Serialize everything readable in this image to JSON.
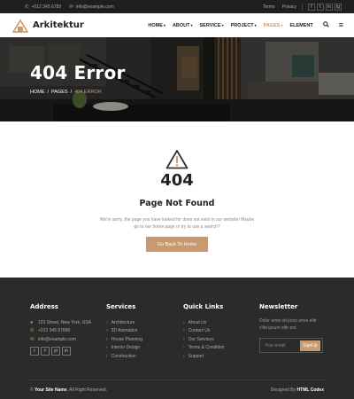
{
  "topbar": {
    "phone": "+012 345 6789",
    "email": "info@example.com",
    "links": [
      "Terms",
      "Privacy"
    ],
    "socials": [
      "f",
      "t",
      "in",
      "ig"
    ]
  },
  "brand": {
    "name": "Arkitektur",
    "accent": "#c89a6e"
  },
  "nav": {
    "items": [
      {
        "label": "HOME",
        "caret": true
      },
      {
        "label": "ABOUT",
        "caret": true
      },
      {
        "label": "SERVICE",
        "caret": true
      },
      {
        "label": "PROJECT",
        "caret": true
      },
      {
        "label": "PAGES",
        "caret": true,
        "active": true
      },
      {
        "label": "ELEMENT",
        "caret": false
      }
    ],
    "caret": "▾",
    "search_icon": "🔍",
    "menu_icon": "≡"
  },
  "hero": {
    "title": "404 Error",
    "breadcrumb": [
      "HOME",
      "PAGES",
      "404 ERROR"
    ],
    "separator": "/"
  },
  "error": {
    "code": "404",
    "title": "Page Not Found",
    "message": "We're sorry, the page you have looked for does not exist in our website! Maybe go to our home page or try to use a search?",
    "button": "Go Back To Home"
  },
  "footer": {
    "address": {
      "heading": "Address",
      "lines": [
        {
          "icon": "map-marker",
          "glyph": "●",
          "text": "123 Street, New York, USA"
        },
        {
          "icon": "phone",
          "glyph": "✆",
          "text": "+012 345 67890"
        },
        {
          "icon": "envelope",
          "glyph": "✉",
          "text": "info@example.com"
        }
      ],
      "socials": [
        "t",
        "f",
        "yt",
        "in"
      ]
    },
    "services": {
      "heading": "Services",
      "items": [
        "Architecture",
        "3D Animation",
        "House Planning",
        "Interior Design",
        "Construction"
      ]
    },
    "quick_links": {
      "heading": "Quick Links",
      "items": [
        "About Us",
        "Contact Us",
        "Our Services",
        "Terms & Condition",
        "Support"
      ]
    },
    "newsletter": {
      "heading": "Newsletter",
      "text": "Dolor amet sit justo amet elitr clita ipsum elitr est.",
      "placeholder": "Your email",
      "button": "SignUp"
    },
    "copyright_prefix": "© ",
    "site_name": "Your Site Name",
    "rights": ", All Right Reserved.",
    "designed_by_prefix": "Designed By ",
    "designer": "HTML Codex",
    "arrow": "›"
  }
}
